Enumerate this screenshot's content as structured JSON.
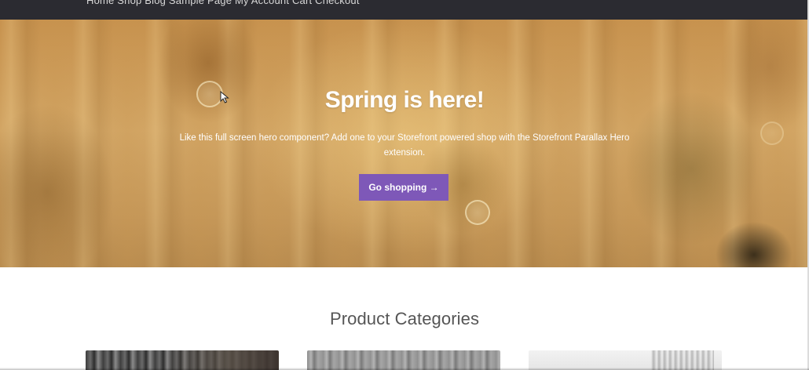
{
  "topbar": {
    "nav_text": "Home    Shop    Blog    Sample Page    My Account    Cart    Checkout"
  },
  "hero": {
    "title": "Spring is here!",
    "description": "Like this full screen hero component? Add one to your Storefront powered shop with the Storefront Parallax Hero extension.",
    "button_label": "Go shopping →"
  },
  "categories": {
    "title": "Product Categories"
  },
  "colors": {
    "topbar_bg": "#2b2b31",
    "button_bg": "#7e58b8",
    "hero_tint": "#d2a564",
    "heading_text": "#555555"
  },
  "icons": {
    "cursor": "mouse-pointer-icon"
  }
}
